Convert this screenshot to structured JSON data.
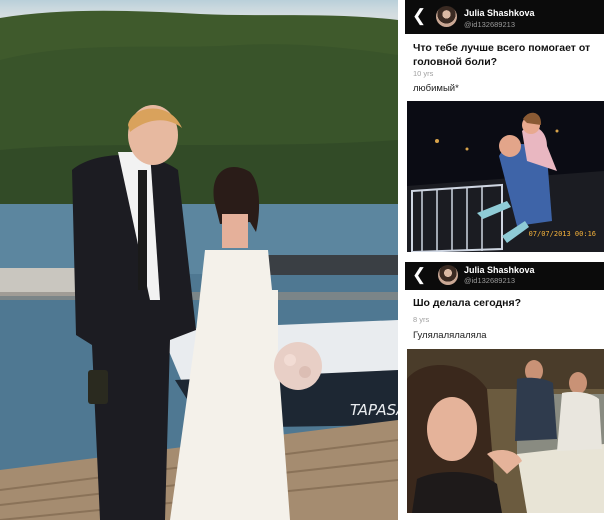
{
  "photo": {
    "boat_name": "TAPASA"
  },
  "posts": [
    {
      "user": {
        "name": "Julia Shashkova",
        "id": "@id132689213"
      },
      "question": "Что тебе лучше всего помогает от головной боли?",
      "meta": "10 yrs",
      "answer": "любимый*",
      "photo_stamp": "07/07/2013 00:16"
    },
    {
      "user": {
        "name": "Julia Shashkova",
        "id": "@id132689213"
      },
      "question": "Шо делала сегодня?",
      "meta": "8 yrs",
      "answer": "Гулялалялаляла"
    }
  ],
  "icons": {
    "back": "back-arrow-icon",
    "avatar": "avatar"
  },
  "colors": {
    "app_bar": "#0b0b0b",
    "stamp": "#f5b23a"
  }
}
